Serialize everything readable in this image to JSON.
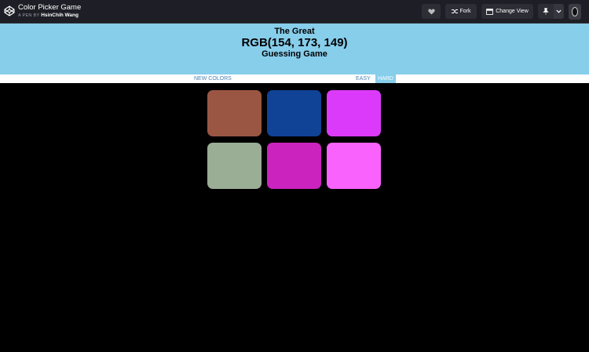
{
  "codepen": {
    "pen_title": "Color Picker Game",
    "by_prefix": "A PEN BY",
    "author": "HsinChih Wang",
    "fork_label": "Fork",
    "change_view_label": "Change View"
  },
  "icons": {
    "logo": "codepen-logo-icon",
    "heart": "heart-icon",
    "fork": "fork-icon",
    "change_view": "layout-icon",
    "pin": "pin-icon",
    "caret": "chevron-down-icon"
  },
  "game": {
    "title_line1": "The Great",
    "rgb_display": "RGB(154, 173, 149)",
    "title_line3": "Guessing Game",
    "header_color": "#87ceeb",
    "new_colors_label": "NEW COLORS",
    "easy_label": "EASY",
    "hard_label": "HARD",
    "selected_mode": "HARD",
    "squares": [
      "rgb(154, 86, 67)",
      "rgb(16, 66, 150)",
      "rgb(220, 58, 250)",
      "rgb(154, 173, 149)",
      "rgb(203, 35, 190)",
      "rgb(249, 98, 253)"
    ]
  }
}
